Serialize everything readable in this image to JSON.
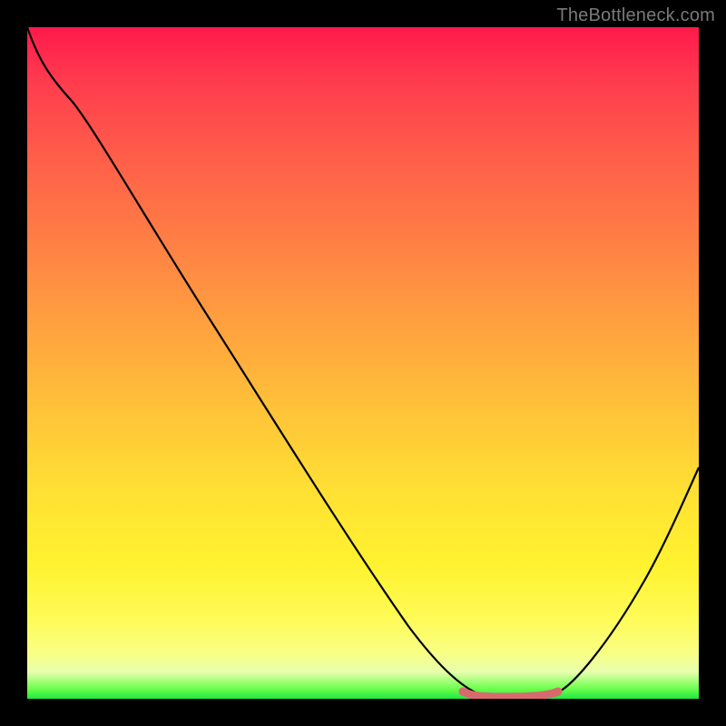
{
  "watermark": "TheBottleneck.com",
  "chart_data": {
    "type": "line",
    "title": "",
    "xlabel": "",
    "ylabel": "",
    "xlim": [
      0,
      100
    ],
    "ylim": [
      0,
      100
    ],
    "series": [
      {
        "name": "bottleneck-curve",
        "x": [
          0,
          5,
          10,
          20,
          30,
          40,
          50,
          60,
          65,
          68,
          72,
          76,
          80,
          85,
          90,
          95,
          100
        ],
        "y": [
          100,
          93,
          88,
          75,
          62,
          49,
          36,
          22,
          12,
          5,
          1,
          0,
          1,
          6,
          15,
          25,
          35
        ]
      }
    ],
    "trough_marker": {
      "x_range": [
        66,
        80
      ],
      "y": 0.5,
      "color": "#d86a6e"
    },
    "background_gradient": {
      "stops": [
        {
          "pos": 0.0,
          "color": "#ff1a4b"
        },
        {
          "pos": 0.3,
          "color": "#ff7a45"
        },
        {
          "pos": 0.6,
          "color": "#ffc538"
        },
        {
          "pos": 0.85,
          "color": "#fffb57"
        },
        {
          "pos": 0.97,
          "color": "#9cff6a"
        },
        {
          "pos": 1.0,
          "color": "#1fe83e"
        }
      ]
    }
  }
}
